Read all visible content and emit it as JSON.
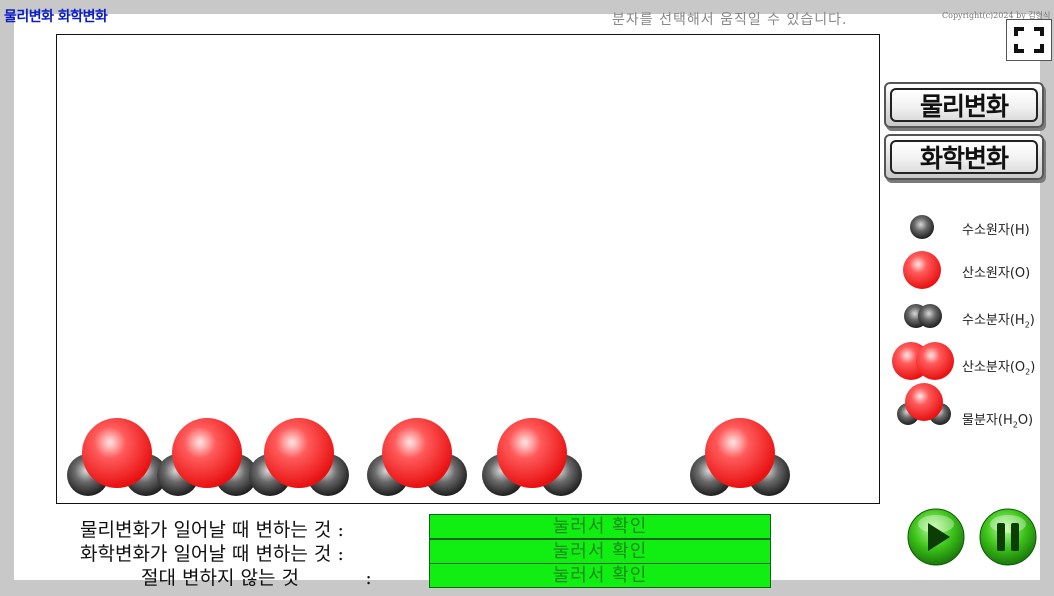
{
  "app": {
    "title": "물리변화 화학변화",
    "hint": "분자를 선택해서  움직일 수 있습니다.",
    "copyright": "Copyright(c)2024 by 김형식"
  },
  "buttons": {
    "physical": "물리변화",
    "chemical": "화학변화"
  },
  "legend": [
    {
      "label": "수소원자(H)",
      "icon": "hydrogen-atom-icon"
    },
    {
      "label": "산소원자(O)",
      "icon": "oxygen-atom-icon"
    },
    {
      "label_prefix": "수소분자(H",
      "sub": "2",
      "label_suffix": ")",
      "icon": "hydrogen-molecule-icon"
    },
    {
      "label_prefix": "산소분자(O",
      "sub": "2",
      "label_suffix": ")",
      "icon": "oxygen-molecule-icon"
    },
    {
      "label_prefix": "물분자(H",
      "sub": "2",
      "label_suffix": "O)",
      "icon": "water-molecule-icon"
    }
  ],
  "questions": [
    {
      "label": "물리변화가 일어날 때 변하는 것 :",
      "button": "눌러서 확인"
    },
    {
      "label": "화학변화가 일어날 때 변하는 것 :",
      "button": "눌러서 확인"
    },
    {
      "label": "절대 변하지 않는 것           :",
      "button": "눌러서 확인"
    }
  ],
  "controls": {
    "play": "play-icon",
    "pause": "pause-icon"
  },
  "colors": {
    "title": "#0a1dc8",
    "answer_button": "#11ee11",
    "oxygen": "#ff2b2b",
    "hydrogen": "#444444"
  }
}
